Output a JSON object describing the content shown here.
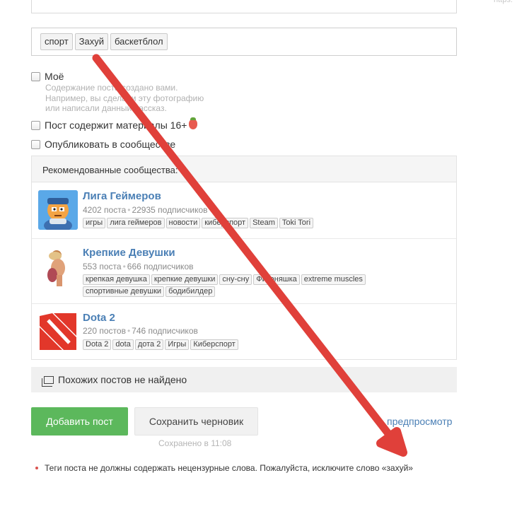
{
  "corner_hint": "https:",
  "tags": [
    "спорт",
    "Захуй",
    "баскетблол"
  ],
  "options": {
    "mine_label": "Моё",
    "mine_hint": "Содержание поста создано вами. Например, вы сделали эту фотографию или написали данный рассказ.",
    "adult_label": "Пост содержит материалы 16+",
    "community_label": "Опубликовать в сообществе"
  },
  "recommended": {
    "heading": "Рекомендованные сообщества:",
    "communities": [
      {
        "name": "Лига Геймеров",
        "posts": "4202 поста",
        "subs": "22935 подписчиков",
        "tags": [
          "игры",
          "лига геймеров",
          "новости",
          "киберспорт",
          "Steam",
          "Toki Tori"
        ]
      },
      {
        "name": "Крепкие Девушки",
        "posts": "553 поста",
        "subs": "666 подписчиков",
        "tags": [
          "крепкая девушка",
          "крепкие девушки",
          "сну-сну",
          "Фитоняшка",
          "extreme muscles",
          "спортивные девушки",
          "бодибилдер"
        ]
      },
      {
        "name": "Dota 2",
        "posts": "220 постов",
        "subs": "746 подписчиков",
        "tags": [
          "Dota 2",
          "dota",
          "дота 2",
          "Игры",
          "Киберспорт"
        ]
      }
    ]
  },
  "similar": "Похожих постов не найдено",
  "actions": {
    "add": "Добавить пост",
    "draft": "Сохранить черновик",
    "preview": "предпросмотр",
    "saved": "Сохранено в 11:08"
  },
  "error": "Теги поста не должны содержать нецензурные слова. Пожалуйста, исключите слово «захуй»",
  "colors": {
    "accent_green": "#5cb85c",
    "link_blue": "#4a7fb5",
    "annotation_arrow": "#e0403a"
  }
}
